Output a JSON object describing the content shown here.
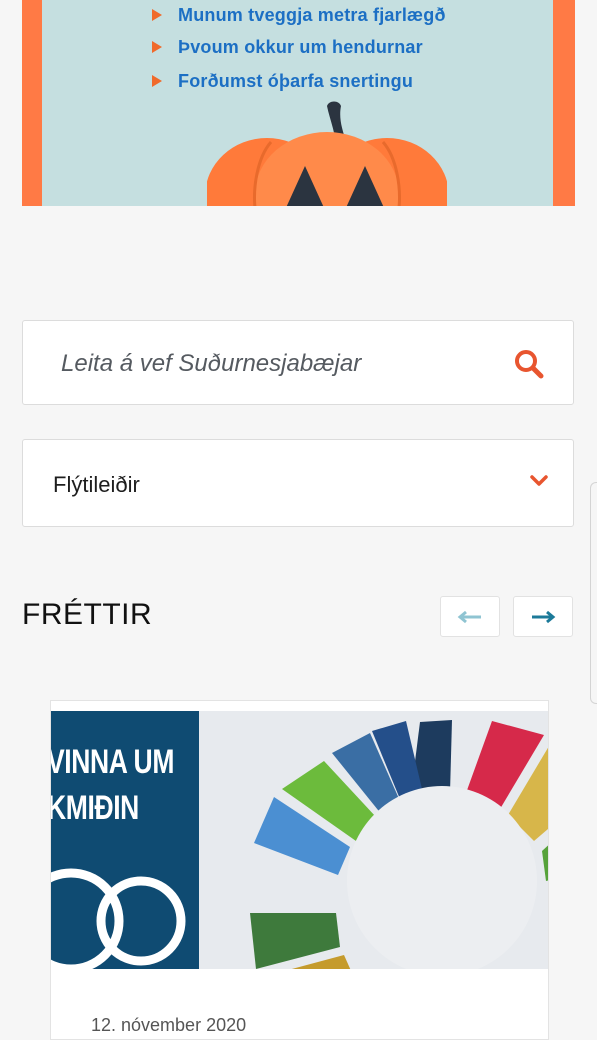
{
  "banner": {
    "bullets": [
      "Munum tveggja metra fjarlægð",
      "Þvoum okkur um hendurnar",
      "Forðumst óþarfa snertingu"
    ],
    "colors": {
      "frame": "#ff7a45",
      "background": "#c5dfe0",
      "text": "#1c6fc4",
      "pumpkin": "#ff7a3a"
    }
  },
  "search": {
    "placeholder": "Leita á vef Suðurnesjabæjar",
    "icon": "search-icon"
  },
  "quicklinks": {
    "label": "Flýtileiðir",
    "icon": "chevron-down-icon"
  },
  "news": {
    "title": "FRÉTTIR",
    "prev_icon": "arrow-left-icon",
    "next_icon": "arrow-right-icon",
    "items": [
      {
        "image_text": "VINNA UM\nKMIÐIN",
        "date": "12. nóvember 2020"
      }
    ]
  },
  "accent_color": "#e8552f"
}
